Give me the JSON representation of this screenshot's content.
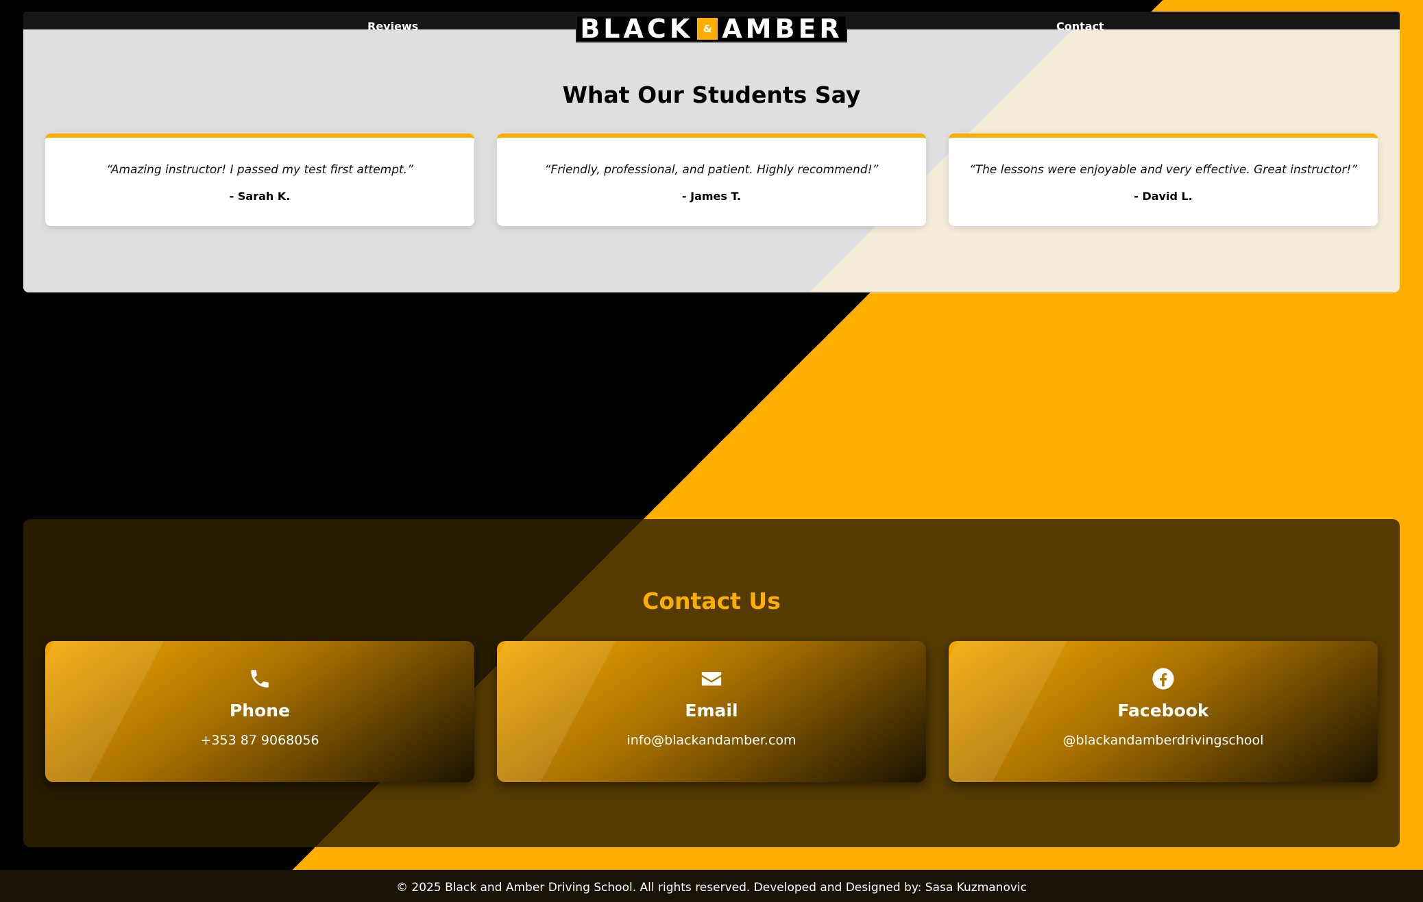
{
  "nav": {
    "reviews_label": "Reviews",
    "contact_label": "Contact"
  },
  "logo": {
    "word_left": "BLACK",
    "ampersand": "&",
    "word_right": "AMBER"
  },
  "reviews": {
    "title": "What Our Students Say",
    "items": [
      {
        "quote": "“Amazing instructor! I passed my test first attempt.”",
        "author": "- Sarah K."
      },
      {
        "quote": "“Friendly, professional, and patient. Highly recommend!”",
        "author": "- James T."
      },
      {
        "quote": "“The lessons were enjoyable and very effective. Great instructor!”",
        "author": "- David L."
      }
    ]
  },
  "contact": {
    "title": "Contact Us",
    "cards": [
      {
        "icon": "phone-icon",
        "title": "Phone",
        "value": "+353 87 9068056"
      },
      {
        "icon": "envelope-icon",
        "title": "Email",
        "value": "info@blackandamber.com"
      },
      {
        "icon": "facebook-icon",
        "title": "Facebook",
        "value": "@blackandamberdrivingschool"
      }
    ]
  },
  "footer": {
    "text": "© 2025 Black and Amber Driving School. All rights reserved. Developed and Designed by: Sasa Kuzmanovic"
  },
  "colors": {
    "amber": "#FFAE00",
    "black": "#000000",
    "contact_bg": "#302200"
  }
}
